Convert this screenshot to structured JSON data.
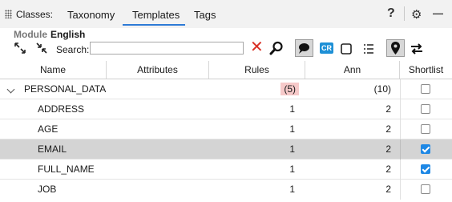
{
  "header": {
    "classes_label": "Classes:",
    "tabs": [
      {
        "label": "Taxonomy",
        "active": false
      },
      {
        "label": "Templates",
        "active": true
      },
      {
        "label": "Tags",
        "active": false
      }
    ],
    "help_glyph": "?",
    "gear_glyph": "⚙",
    "minimize_glyph": "—"
  },
  "module": {
    "label": "Module",
    "value": "English"
  },
  "toolbar": {
    "search_label": "Search:",
    "search_value": "",
    "search_placeholder": "",
    "clear_glyph": "✕",
    "cr_label": "CR"
  },
  "table": {
    "columns": [
      "Name",
      "Attributes",
      "Rules",
      "Ann",
      "Shortlist"
    ],
    "group": {
      "name": "PERSONAL_DATA",
      "rules": "(5)",
      "ann": "(10)"
    },
    "rows": [
      {
        "name": "ADDRESS",
        "rules": "1",
        "ann": "2",
        "shortlist": false,
        "selected": false
      },
      {
        "name": "AGE",
        "rules": "1",
        "ann": "2",
        "shortlist": false,
        "selected": false
      },
      {
        "name": "EMAIL",
        "rules": "1",
        "ann": "2",
        "shortlist": true,
        "selected": true
      },
      {
        "name": "FULL_NAME",
        "rules": "1",
        "ann": "2",
        "shortlist": true,
        "selected": false
      },
      {
        "name": "JOB",
        "rules": "1",
        "ann": "2",
        "shortlist": false,
        "selected": false
      }
    ]
  },
  "colors": {
    "accent": "#2e7bd6",
    "checkbox_on": "#1e88e5",
    "clear": "#d93025",
    "badge": "#f6c9c9"
  }
}
